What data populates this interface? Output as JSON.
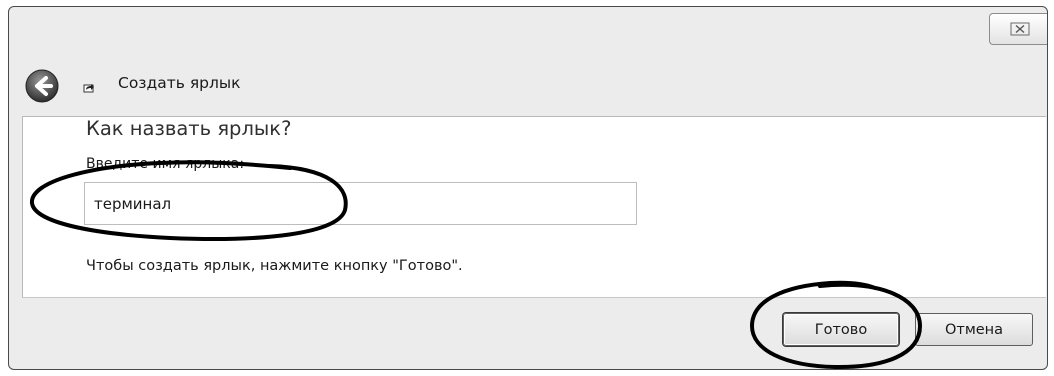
{
  "window": {
    "close_glyph": "⊠"
  },
  "header": {
    "title": "Создать ярлык"
  },
  "main": {
    "heading": "Как назвать ярлык?",
    "name_label": "Введите имя ярлыка:",
    "name_value": "терминал",
    "hint": "Чтобы создать ярлык, нажмите кнопку \"Готово\"."
  },
  "buttons": {
    "finish": "Готово",
    "cancel": "Отмена"
  },
  "icons": {
    "back": "back-arrow-icon",
    "shortcut": "shortcut-icon",
    "close": "close-icon"
  },
  "colors": {
    "window_background": "#ececec",
    "content_background": "#ffffff",
    "annotation_stroke": "#000000"
  }
}
